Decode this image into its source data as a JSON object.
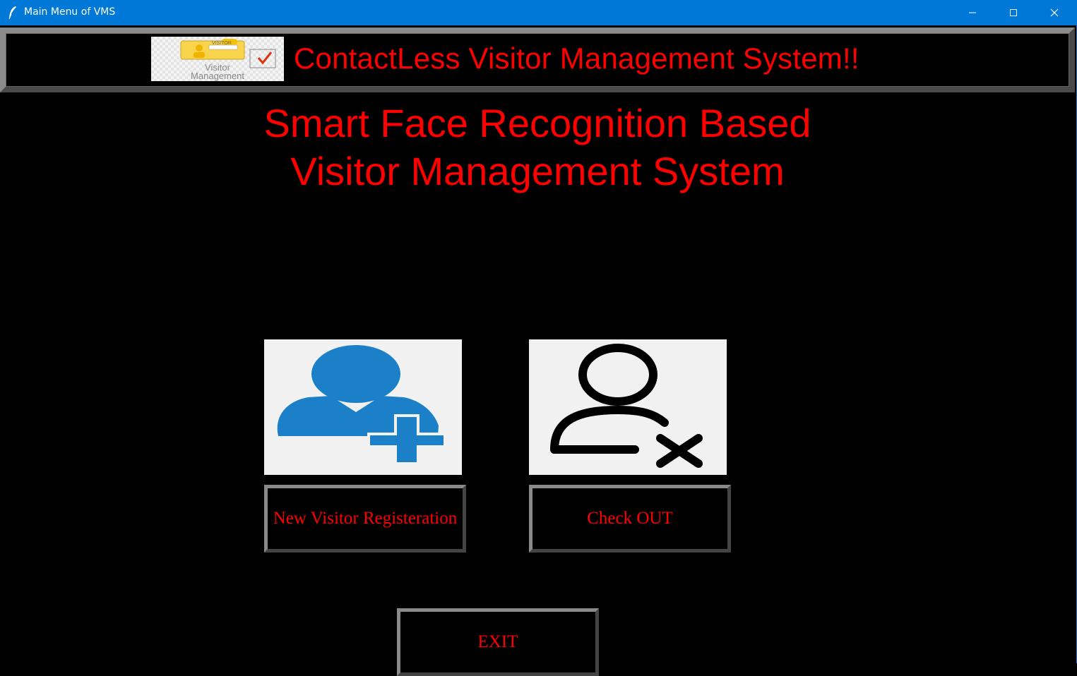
{
  "window": {
    "title": "Main Menu of VMS",
    "minimize_glyph": "—",
    "close_glyph": "✕"
  },
  "header": {
    "logo_label_top": "VISITOR",
    "logo_label_line1": "Visitor",
    "logo_label_line2": "Management",
    "title": "ContactLess Visitor Management System!!"
  },
  "main": {
    "title_line1": "Smart Face Recognition Based",
    "title_line2": "Visitor Management System"
  },
  "buttons": {
    "new_visitor": "New Visitor Registeration",
    "check_out": "Check OUT",
    "exit": "EXIT"
  },
  "icons": {
    "new_visitor_image": "user-add-icon",
    "check_out_image": "user-remove-icon",
    "new_visitor_color": "#1b80c8",
    "check_out_color": "#000000"
  },
  "colors": {
    "accent_text": "#ff0000",
    "titlebar": "#0078d7",
    "background": "#000000"
  }
}
